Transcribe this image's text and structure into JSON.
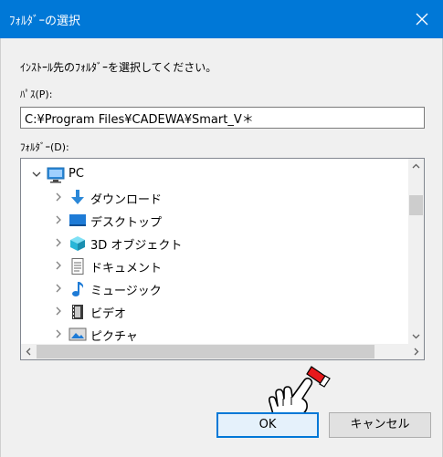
{
  "window": {
    "title": "ﾌｫﾙﾀﾞｰの選択"
  },
  "dialog": {
    "instruction": "ｲﾝｽﾄｰﾙ先のﾌｫﾙﾀﾞｰを選択してください。",
    "path_label": "ﾊﾟｽ(P):",
    "path_value": "C:¥Program Files¥CADEWA¥Smart_V＊",
    "folder_label": "ﾌｫﾙﾀﾞｰ(D):"
  },
  "tree": {
    "items": [
      {
        "label": "PC",
        "icon": "pc-icon"
      },
      {
        "label": "ダウンロード",
        "icon": "download-icon"
      },
      {
        "label": "デスクトップ",
        "icon": "desktop-icon"
      },
      {
        "label": "3D オブジェクト",
        "icon": "3d-objects-icon"
      },
      {
        "label": "ドキュメント",
        "icon": "documents-icon"
      },
      {
        "label": "ミュージック",
        "icon": "music-icon"
      },
      {
        "label": "ビデオ",
        "icon": "video-icon"
      },
      {
        "label": "ピクチャ",
        "icon": "pictures-icon"
      }
    ]
  },
  "buttons": {
    "ok": "OK",
    "cancel": "キャンセル"
  },
  "colors": {
    "titlebar": "#0078d7",
    "accent": "#0078d7"
  }
}
